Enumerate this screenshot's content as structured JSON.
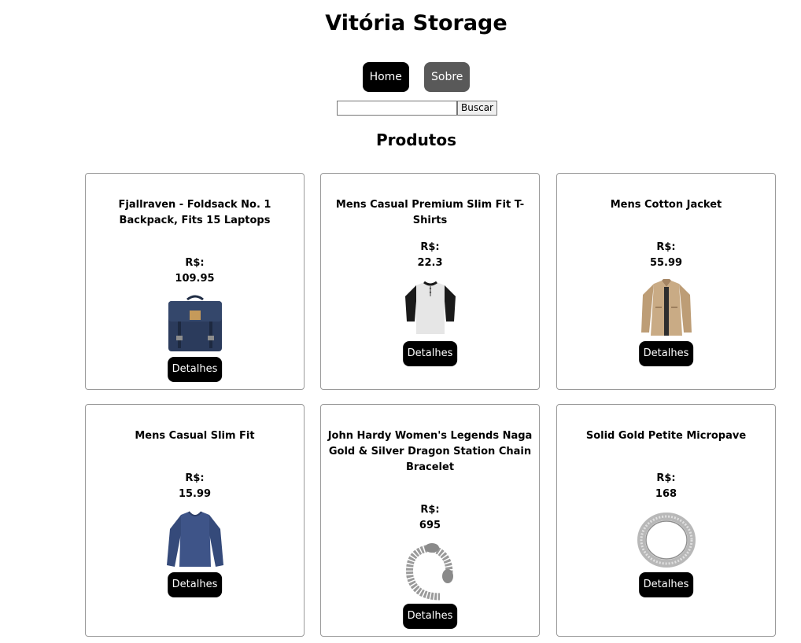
{
  "header": {
    "title": "Vitória Storage"
  },
  "nav": {
    "home_label": "Home",
    "sobre_label": "Sobre"
  },
  "search": {
    "value": "",
    "placeholder": "",
    "button_label": "Buscar"
  },
  "section_title": "Produtos",
  "currency_label": "R$:",
  "details_label": "Detalhes",
  "products": [
    {
      "name": "Fjallraven - Foldsack No. 1 Backpack, Fits 15 Laptops",
      "price": "109.95",
      "image": "backpack"
    },
    {
      "name": "Mens Casual Premium Slim Fit T-Shirts",
      "price": "22.3",
      "image": "tshirt"
    },
    {
      "name": "Mens Cotton Jacket",
      "price": "55.99",
      "image": "jacket"
    },
    {
      "name": "Mens Casual Slim Fit",
      "price": "15.99",
      "image": "longsleeve"
    },
    {
      "name": "John Hardy Women's Legends Naga Gold & Silver Dragon Station Chain Bracelet",
      "price": "695",
      "image": "bracelet"
    },
    {
      "name": "Solid Gold Petite Micropave",
      "price": "168",
      "image": "ring"
    }
  ]
}
